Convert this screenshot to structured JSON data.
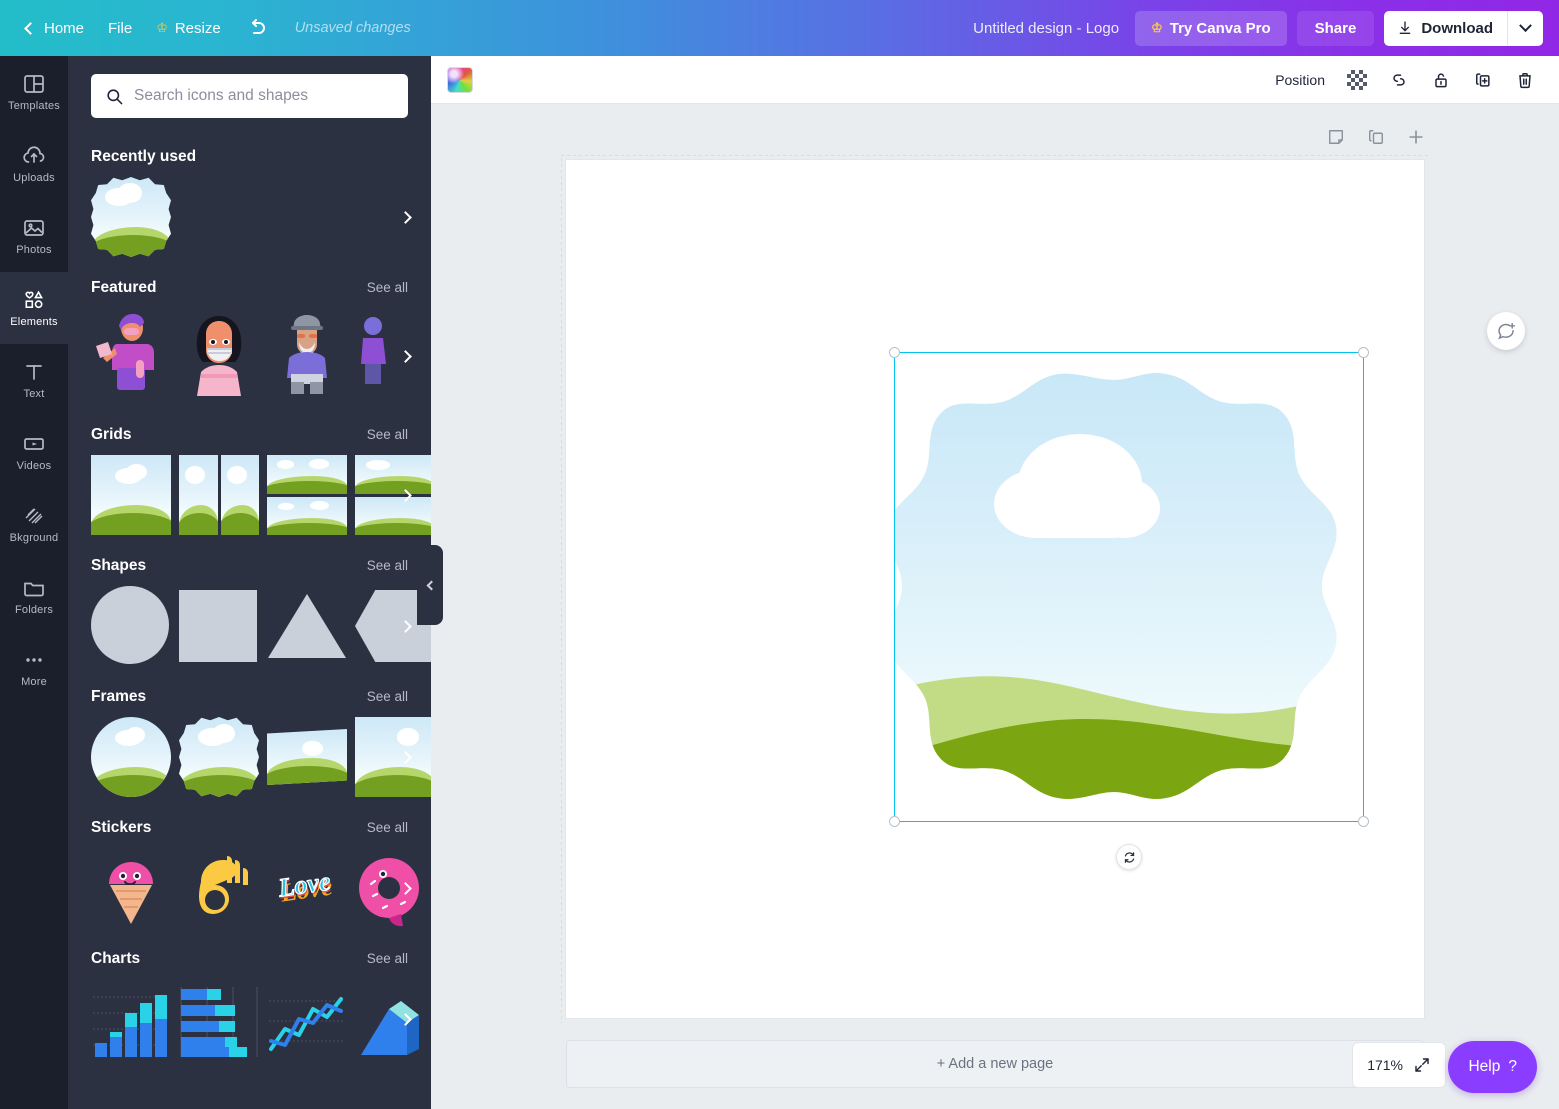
{
  "topbar": {
    "home_label": "Home",
    "file_label": "File",
    "resize_label": "Resize",
    "undo_icon": "undo-icon",
    "status_text": "Unsaved changes",
    "doc_title": "Untitled design - Logo",
    "pro_label": "Try Canva Pro",
    "share_label": "Share",
    "download_label": "Download",
    "crown_icon": "crown-icon",
    "accent_start": "#23bdc9",
    "accent_end": "#9127e6"
  },
  "rail": {
    "items": [
      {
        "label": "Templates",
        "icon": "templates-icon",
        "active": false
      },
      {
        "label": "Uploads",
        "icon": "upload-cloud-icon",
        "active": false
      },
      {
        "label": "Photos",
        "icon": "photo-icon",
        "active": false
      },
      {
        "label": "Elements",
        "icon": "elements-icon",
        "active": true
      },
      {
        "label": "Text",
        "icon": "text-icon",
        "active": false
      },
      {
        "label": "Videos",
        "icon": "video-icon",
        "active": false
      },
      {
        "label": "Bkground",
        "icon": "background-icon",
        "active": false
      },
      {
        "label": "Folders",
        "icon": "folder-icon",
        "active": false
      },
      {
        "label": "More",
        "icon": "more-dots-icon",
        "active": false
      }
    ]
  },
  "panel": {
    "search": {
      "placeholder": "Search icons and shapes",
      "value": "",
      "icon": "search-icon"
    },
    "see_all_label": "See all",
    "sections": [
      {
        "title": "Recently used",
        "see_all": false
      },
      {
        "title": "Featured",
        "see_all": true
      },
      {
        "title": "Grids",
        "see_all": true
      },
      {
        "title": "Shapes",
        "see_all": true
      },
      {
        "title": "Frames",
        "see_all": true
      },
      {
        "title": "Stickers",
        "see_all": true
      },
      {
        "title": "Charts",
        "see_all": true
      }
    ],
    "stickers": [
      "🍦",
      "👌",
      "Love",
      "🍩"
    ],
    "collapse_icon": "chevron-left-icon"
  },
  "object_toolbar": {
    "color_swatch": "rainbow-color-swatch",
    "position_label": "Position",
    "transparency_icon": "transparency-icon",
    "link_icon": "link-icon",
    "lock_icon": "lock-icon",
    "duplicate_icon": "duplicate-icon",
    "delete_icon": "trash-icon"
  },
  "page_tools": {
    "notes_icon": "notes-icon",
    "duplicate_page_icon": "duplicate-page-icon",
    "add_page_icon": "plus-icon"
  },
  "canvas": {
    "selected_element": "cloud-landscape-blob-frame",
    "rotate_icon": "rotate-icon",
    "selection_color": "#00c4ef",
    "comment_icon": "add-comment-icon"
  },
  "footer": {
    "add_page_label": "+ Add a new page",
    "zoom_level": "171%",
    "fit_icon": "fit-screen-icon",
    "help_label": "Help",
    "help_mark": "?",
    "help_color": "#8b3dff"
  }
}
